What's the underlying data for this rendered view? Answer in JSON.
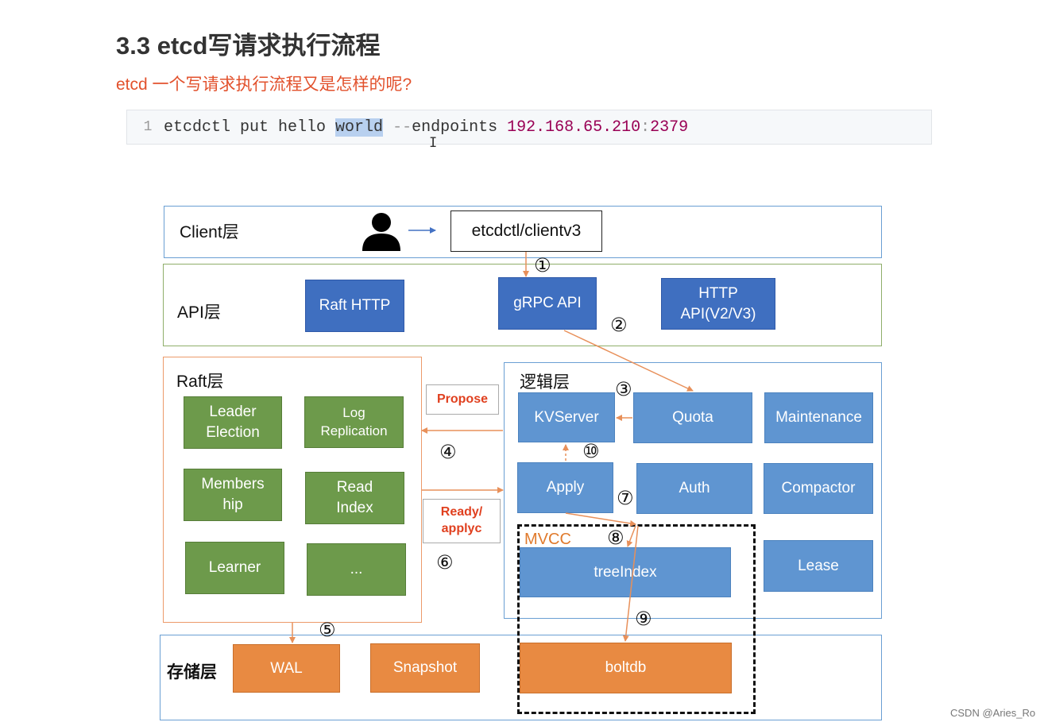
{
  "heading": {
    "title": "3.3 etcd写请求执行流程",
    "subtitle": "etcd 一个写请求执行流程又是怎样的呢?"
  },
  "code": {
    "line_number": "1",
    "tokens": {
      "cmd": "etcdctl put hello ",
      "highlighted": "world",
      "space": " ",
      "op": "--",
      "flag": "endpoints ",
      "ip": "192.168.65.210",
      "colon": ":",
      "port": "2379"
    },
    "cursor": "I"
  },
  "diagram": {
    "layers": {
      "client": "Client层",
      "api": "API层",
      "raft": "Raft层",
      "logic": "逻辑层",
      "storage": "存储层"
    },
    "client": {
      "tool": "etcdctl/clientv3"
    },
    "api": {
      "raft_http": "Raft HTTP",
      "grpc": "gRPC API",
      "http": "HTTP\nAPI(V2/V3)"
    },
    "raft": {
      "leader_election": "Leader\nElection",
      "log_replication": "Log\nReplication",
      "membership": "Members\nhip",
      "read_index": "Read\nIndex",
      "learner": "Learner",
      "more": "..."
    },
    "messages": {
      "propose": "Propose",
      "ready": "Ready/\napplyc"
    },
    "logic": {
      "kvserver": "KVServer",
      "quota": "Quota",
      "maintenance": "Maintenance",
      "apply": "Apply",
      "auth": "Auth",
      "compactor": "Compactor",
      "lease": "Lease"
    },
    "mvcc": {
      "label": "MVCC",
      "tree_index": "treeIndex"
    },
    "storage": {
      "wal": "WAL",
      "snapshot": "Snapshot",
      "boltdb": "boltdb"
    },
    "steps": [
      "①",
      "②",
      "③",
      "④",
      "⑤",
      "⑥",
      "⑦",
      "⑧",
      "⑨",
      "⑩"
    ]
  },
  "watermark": "CSDN @Aries_Ro",
  "colors": {
    "heading_text": "#333333",
    "subtitle_text": "#e2512c",
    "api_box": "#3f6fc0",
    "logic_box": "#5f95d1",
    "raft_box": "#6d9a4b",
    "storage_box": "#e88a42",
    "arrow": "#e8905a",
    "label_text": "#e0401f"
  }
}
